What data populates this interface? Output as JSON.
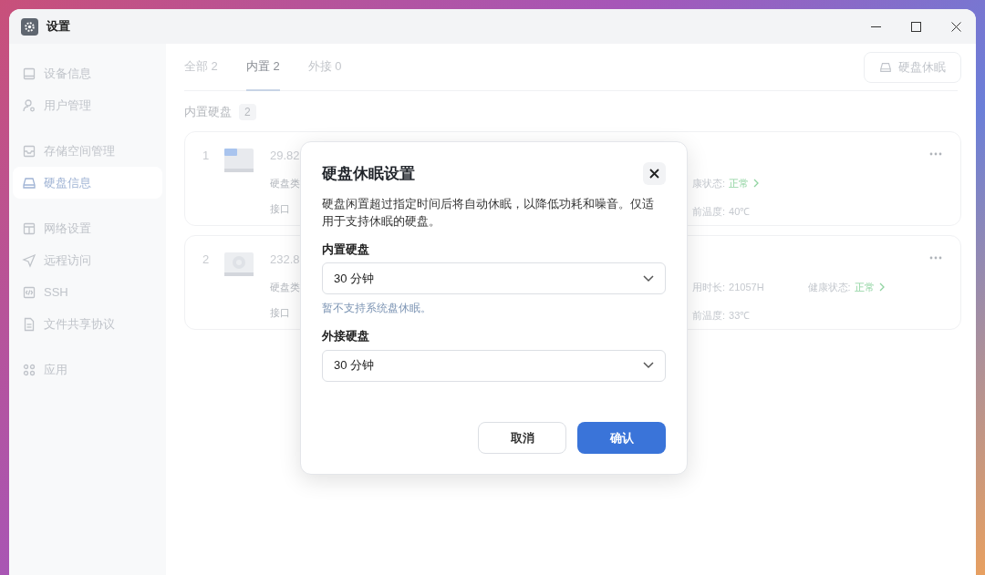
{
  "window": {
    "title": "设置"
  },
  "sidebar": {
    "groups": [
      [
        {
          "label": "设备信息",
          "selected": false
        },
        {
          "label": "用户管理",
          "selected": false
        }
      ],
      [
        {
          "label": "存储空间管理",
          "selected": false
        },
        {
          "label": "硬盘信息",
          "selected": true
        }
      ],
      [
        {
          "label": "网络设置",
          "selected": false
        },
        {
          "label": "远程访问",
          "selected": false
        },
        {
          "label": "SSH",
          "selected": false
        },
        {
          "label": "文件共享协议",
          "selected": false
        }
      ],
      [
        {
          "label": "应用",
          "selected": false
        }
      ]
    ]
  },
  "tabs": [
    {
      "label": "全部 2",
      "selected": false
    },
    {
      "label": "内置 2",
      "selected": true
    },
    {
      "label": "外接 0",
      "selected": false
    }
  ],
  "toolbar": {
    "sleep_button": "硬盘休眠"
  },
  "section": {
    "title": "内置硬盘",
    "count": "2"
  },
  "disks": [
    {
      "number": "1",
      "kind": "ssd",
      "capacity": "29.82",
      "type_label": "硬盘类",
      "interface_label": "接口",
      "right_rows": [
        [
          {
            "label": "康状态:",
            "value": "正常",
            "kind": "status"
          }
        ],
        [
          {
            "label": "前温度:",
            "value": "40℃",
            "kind": "text"
          }
        ]
      ]
    },
    {
      "number": "2",
      "kind": "hdd",
      "capacity": "232.8",
      "type_label": "硬盘类",
      "interface_label": "接口",
      "right_rows": [
        [
          {
            "label": "用时长:",
            "value": "21057H",
            "kind": "text"
          },
          {
            "label": "健康状态:",
            "value": "正常",
            "kind": "status"
          }
        ],
        [
          {
            "label": "前温度:",
            "value": "33℃",
            "kind": "text"
          }
        ]
      ]
    }
  ],
  "dialog": {
    "title": "硬盘休眠设置",
    "description": "硬盘闲置超过指定时间后将自动休眠，以降低功耗和噪音。仅适用于支持休眠的硬盘。",
    "fields": [
      {
        "label": "内置硬盘",
        "value": "30 分钟",
        "hint": "暂不支持系统盘休眠。"
      },
      {
        "label": "外接硬盘",
        "value": "30 分钟"
      }
    ],
    "buttons": {
      "cancel": "取消",
      "confirm": "确认"
    }
  }
}
